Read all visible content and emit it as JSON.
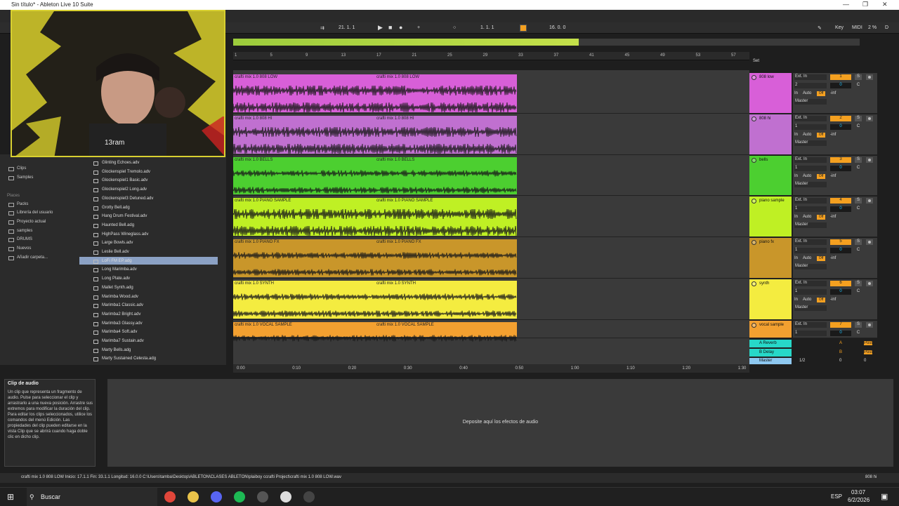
{
  "window": {
    "title": "Sin título* - Ableton Live 10 Suite",
    "controls": [
      "—",
      "❐",
      "✕"
    ]
  },
  "transport": {
    "tempo": "21.  1.  1",
    "position": "1.  1.  1",
    "loop_length": "16.  0.  0",
    "key_label": "Key",
    "midi_label": "MIDI",
    "cpu": "2 %",
    "d_label": "D"
  },
  "ruler": {
    "bars": [
      "1",
      "5",
      "9",
      "13",
      "17",
      "21",
      "25",
      "29",
      "33",
      "37",
      "41",
      "45",
      "49",
      "53",
      "57"
    ]
  },
  "set_label": "Set",
  "tracks": [
    {
      "name": "808 low",
      "clip": "crafti mix 1.0 808 LOW",
      "color": "#d85fd8",
      "number": "1",
      "input": "Ext. In",
      "channel": "2",
      "volume": "0"
    },
    {
      "name": "808 hi",
      "clip": "crafti mix 1.0 808 HI",
      "color": "#c070d0",
      "number": "2",
      "input": "Ext. In",
      "channel": "1",
      "volume": "0"
    },
    {
      "name": "bells",
      "clip": "crafti mix 1.0 BELLS",
      "color": "#4ccf30",
      "number": "3",
      "input": "Ext. In",
      "channel": "1",
      "volume": "0"
    },
    {
      "name": "piano sample",
      "clip": "crafti mix 1.0 PIANO SAMPLE",
      "color": "#bff024",
      "number": "4",
      "input": "Ext. In",
      "channel": "1",
      "volume": "0"
    },
    {
      "name": "piano fx",
      "clip": "crafti mix 1.0 PIANO FX",
      "color": "#c9962a",
      "number": "5",
      "input": "Ext. In",
      "channel": "1",
      "volume": "0"
    },
    {
      "name": "synth",
      "clip": "crafti mix 1.0 SYNTH",
      "color": "#f4ec40",
      "number": "6",
      "input": "Ext. In",
      "channel": "1",
      "volume": "0"
    },
    {
      "name": "vocal sample",
      "clip": "crafti mix 1.0 VOCAL SAMPLE",
      "color": "#f3a030",
      "number": "7",
      "input": "Ext. In",
      "channel": "1",
      "volume": "0"
    }
  ],
  "mixer_labels": {
    "monitor_in": "In",
    "monitor_auto": "Auto",
    "monitor_off": "Off",
    "inf": "-inf",
    "master": "Master",
    "solo": "S",
    "c": "C"
  },
  "returns": [
    {
      "name": "A Reverb",
      "letter": "A",
      "post": "Post"
    },
    {
      "name": "B Delay",
      "letter": "B",
      "post": "Post"
    }
  ],
  "master": {
    "name": "Master",
    "ratio": "1/2",
    "vol_a": "0",
    "vol_b": "0"
  },
  "time_axis": [
    "0:00",
    "0:10",
    "0:20",
    "0:30",
    "0:40",
    "0:50",
    "1:00",
    "1:10",
    "1:20",
    "1:30"
  ],
  "browser": {
    "places_header": "Places",
    "places": [
      "Clips",
      "Samples",
      "Packs",
      "Librería del usuario",
      "Proyecto actual",
      "samples",
      "DRUMS",
      "Nuevos",
      "Añadir carpeta..."
    ],
    "files": [
      "Glinting Echoes.adv",
      "Glockenspiel Tremolo.adv",
      "Glockenspiel1 Basic.adv",
      "Glockenspiel2 Long.adv",
      "Glockenspiel3 Detuned.adv",
      "Grotty Bell.adg",
      "Hang Drum Festival.adv",
      "Haunted Bell.adg",
      "HighPass Wineglass.adv",
      "Large Bowls.adv",
      "Leslie Bell.adv",
      "LoFi FM EP.adg",
      "Long Marimba.adv",
      "Long Plate.adv",
      "Mallet Synth.adg",
      "Marimba Wood.adv",
      "Marimba1 Classic.adv",
      "Marimba2 Bright.adv",
      "Marimba3 Glassy.adv",
      "Marimba4 Soft.adv",
      "Marimba7 Sustain.adv",
      "Marty Bells.adg",
      "Marty Sustained Celesta.adg"
    ],
    "selected_index": 11
  },
  "webcam": {
    "caption": "13ram"
  },
  "info": {
    "title": "Clip de audio",
    "body": "Un clip que representa un fragmento de audio. Pulse para seleccionar el clip y arrastrarlo a una nueva posición. Arrastre sus extremos para modificar la duración del clip. Para editar los clips seleccionados, utilice los comandos del menú Edición. Las propiedades del clip pueden editarse en la vista Clip que se abrirá cuando haga doble clic en dicho clip."
  },
  "device_panel": {
    "drop_text": "Deposite aquí los efectos de audio"
  },
  "status": {
    "text": "crafti mix 1.0 808 LOW  Inicio: 17.1.1  Fin: 33.1.1  Longitud: 16.0.0  C:\\Users\\tamba\\Desktop\\ABLETON\\CLASES ABLETON\\plaiboy ccrafti Project\\crafti mix 1.0 808 LOW.wav",
    "right": "808 hi"
  },
  "taskbar": {
    "search": "Buscar",
    "lang": "ESP",
    "time": "03:07",
    "date": "6/2/2026",
    "apps": [
      {
        "name": "chrome-icon",
        "color": "#e0463a"
      },
      {
        "name": "folder-icon",
        "color": "#e9c34a"
      },
      {
        "name": "discord-icon",
        "color": "#5865f2"
      },
      {
        "name": "spotify-icon",
        "color": "#1db954"
      },
      {
        "name": "live-icon",
        "color": "#555555"
      },
      {
        "name": "app-icon",
        "color": "#dddddd"
      },
      {
        "name": "obs-icon",
        "color": "#444444"
      }
    ]
  }
}
